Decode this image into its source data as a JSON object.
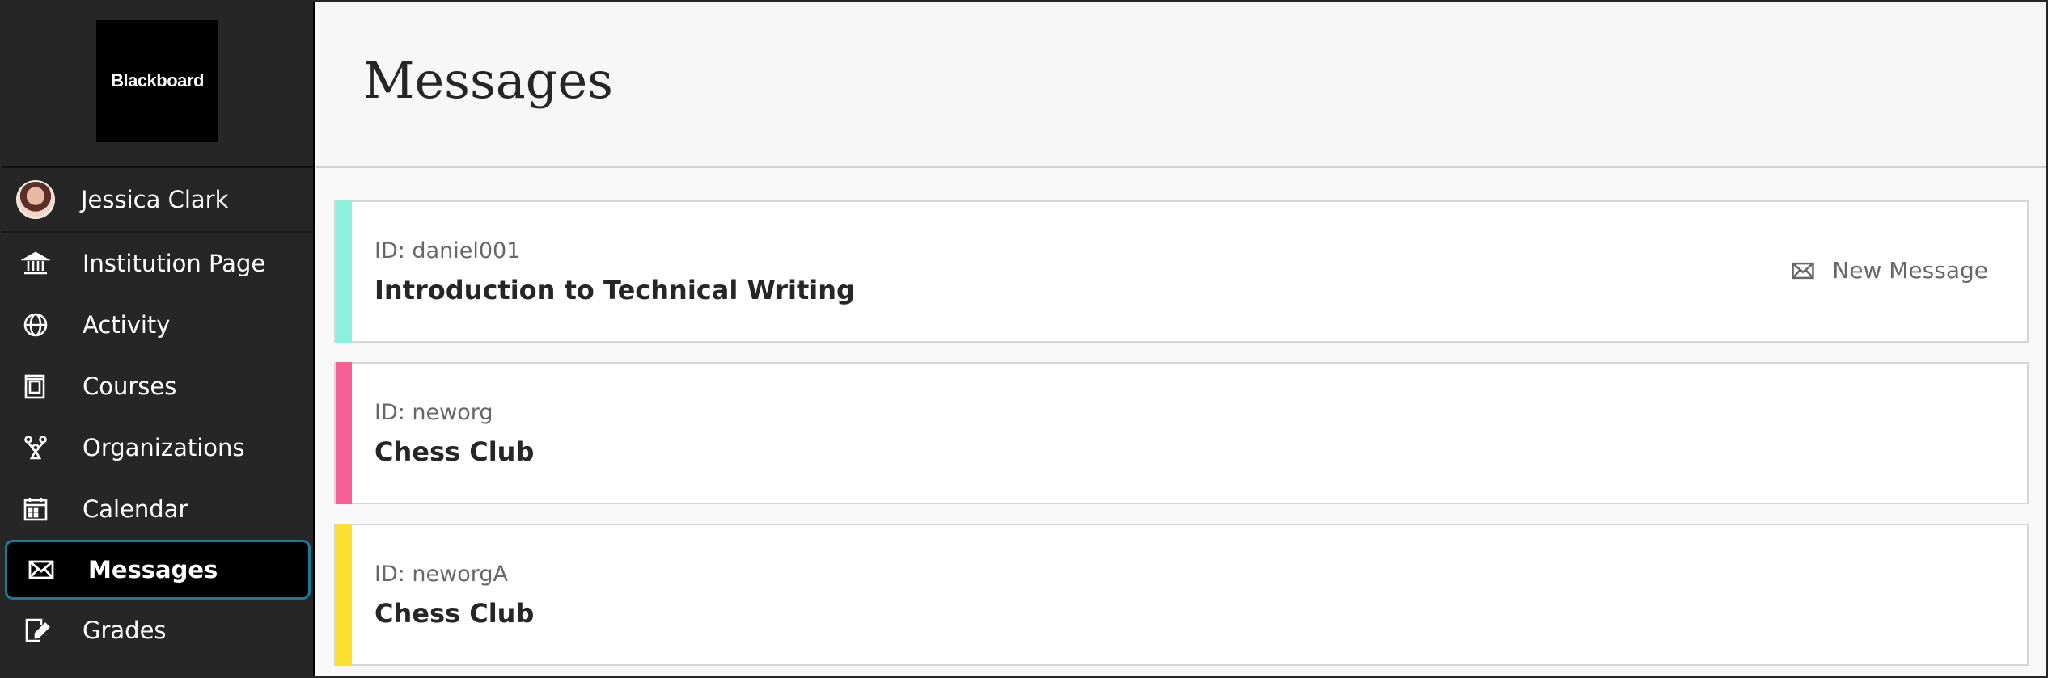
{
  "brand": {
    "logo_text": "Blackboard"
  },
  "sidebar": {
    "user_name": "Jessica Clark",
    "items": [
      {
        "label": "Institution Page",
        "icon": "institution-icon"
      },
      {
        "label": "Activity",
        "icon": "globe-icon"
      },
      {
        "label": "Courses",
        "icon": "courses-icon"
      },
      {
        "label": "Organizations",
        "icon": "organizations-icon"
      },
      {
        "label": "Calendar",
        "icon": "calendar-icon"
      },
      {
        "label": "Messages",
        "icon": "envelope-icon",
        "active": true
      },
      {
        "label": "Grades",
        "icon": "grades-icon"
      }
    ],
    "active_border_color": "#1b7a94"
  },
  "main": {
    "title": "Messages",
    "new_message_label": "New Message",
    "cards": [
      {
        "id": "ID: daniel001",
        "name": "Introduction to Technical Writing",
        "color": "#8cf0dc"
      },
      {
        "id": "ID: neworg",
        "name": "Chess Club",
        "color": "#f76196"
      },
      {
        "id": "ID: neworgA",
        "name": "Chess Club",
        "color": "#fcdf30"
      }
    ]
  }
}
